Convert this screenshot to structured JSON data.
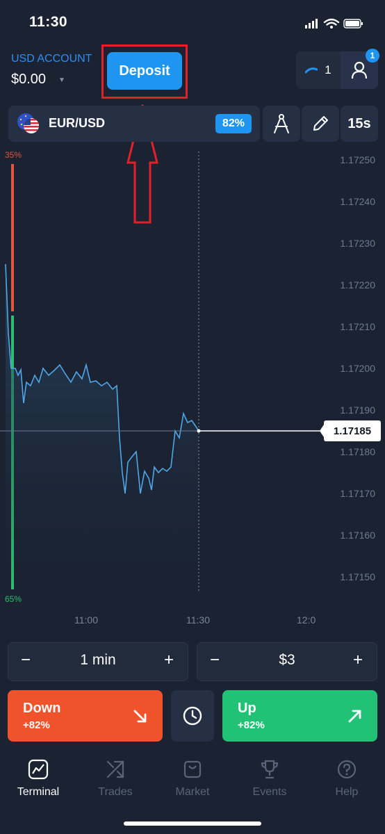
{
  "status_bar": {
    "time": "11:30"
  },
  "header": {
    "account_label": "USD ACCOUNT",
    "balance": "$0.00",
    "deposit_label": "Deposit",
    "charts_count": "1",
    "notifications_badge": "1"
  },
  "asset": {
    "name": "EUR/USD",
    "payout": "82%",
    "timeframe": "15s"
  },
  "chart": {
    "price_ticks": [
      "1.17250",
      "1.17240",
      "1.17230",
      "1.17220",
      "1.17210",
      "1.17200",
      "1.17190",
      "1.17180",
      "1.17170",
      "1.17160",
      "1.17150"
    ],
    "current_price": "1.17185",
    "time_ticks": [
      "11:00",
      "11:30",
      "12:0"
    ],
    "sentiment_down": "35%",
    "sentiment_up": "65%",
    "colors": {
      "down": "#e2553a",
      "up": "#2dbf6f",
      "line": "#4ea7e8"
    }
  },
  "controls": {
    "duration": "1 min",
    "amount": "$3",
    "minus": "−",
    "plus": "+"
  },
  "trade": {
    "down_label": "Down",
    "down_payout": "+82%",
    "up_label": "Up",
    "up_payout": "+82%",
    "colors": {
      "down": "#f0522b",
      "up": "#21c276"
    }
  },
  "nav": {
    "items": [
      {
        "label": "Terminal",
        "icon": "terminal-icon",
        "active": true
      },
      {
        "label": "Trades",
        "icon": "trades-icon",
        "active": false
      },
      {
        "label": "Market",
        "icon": "market-icon",
        "active": false
      },
      {
        "label": "Events",
        "icon": "trophy-icon",
        "active": false
      },
      {
        "label": "Help",
        "icon": "help-icon",
        "active": false
      }
    ]
  }
}
